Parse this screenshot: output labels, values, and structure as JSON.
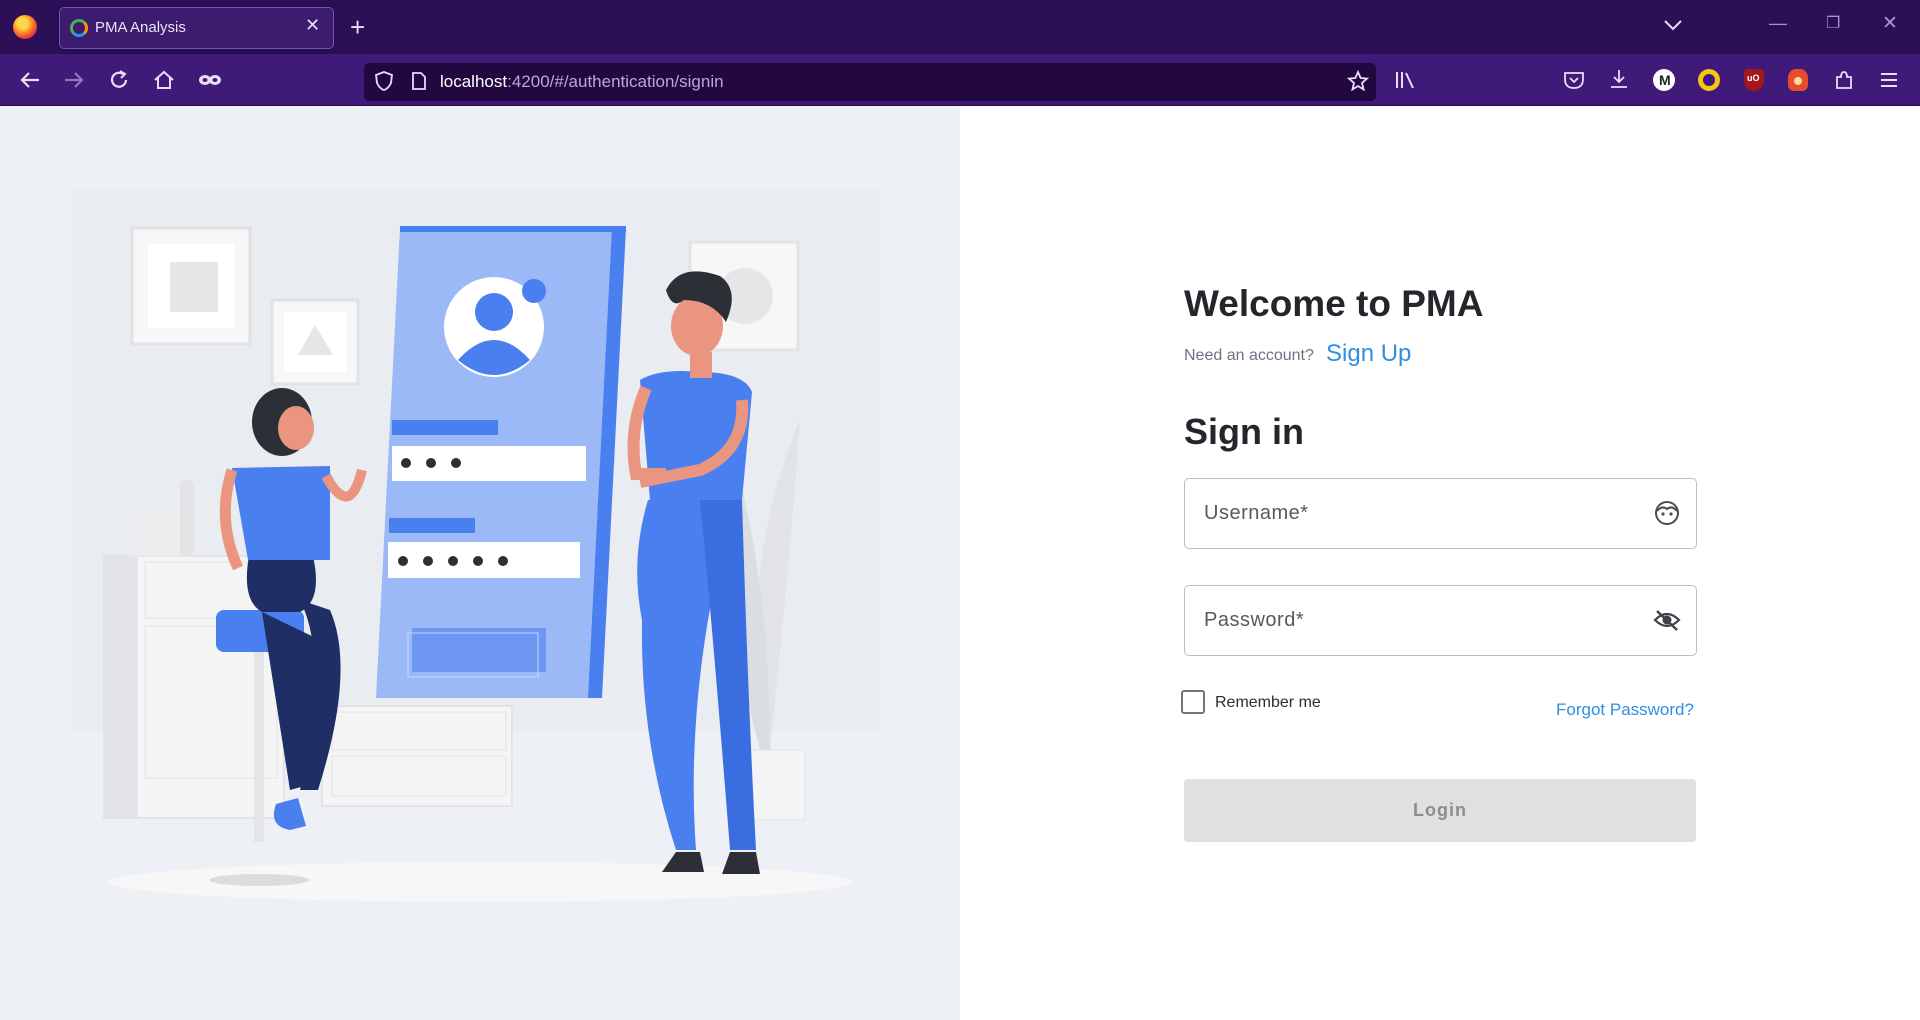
{
  "browser": {
    "tab_title": "PMA Analysis",
    "url_host": "localhost",
    "url_path": ":4200/#/authentication/signin"
  },
  "icons": {
    "firefox": "firefox-logo-icon",
    "close_tab": "close-icon",
    "new_tab": "plus-icon",
    "list_tabs": "chevron-down-icon",
    "back": "arrow-left-icon",
    "forward": "arrow-right-icon",
    "reload": "reload-icon",
    "home": "home-icon",
    "private": "mask-icon",
    "shield": "shield-icon",
    "page": "page-icon",
    "bookmark": "star-icon",
    "library": "library-icon",
    "pocket": "pocket-icon",
    "downloads": "download-icon",
    "menu": "hamburger-icon",
    "username": "face-icon",
    "password": "eye-off-icon"
  },
  "extensions": [
    {
      "name": "m-extension",
      "color": "#ffffff"
    },
    {
      "name": "coin-extension",
      "color": "#f5c518"
    },
    {
      "name": "ublock-extension",
      "color": "#a3161b"
    },
    {
      "name": "fox-extension",
      "color": "#e54d2e"
    }
  ],
  "login": {
    "welcome": "Welcome to PMA",
    "need_account": "Need an account?",
    "sign_up": "Sign Up",
    "sign_in_title": "Sign in",
    "username_label": "Username*",
    "password_label": "Password*",
    "remember_me": "Remember me",
    "forgot_password": "Forgot Password?",
    "login_button": "Login"
  },
  "colors": {
    "accent": "#2f8fe0",
    "illustration_blue": "#4a7ff0",
    "browser_purple": "#3f1a78"
  }
}
